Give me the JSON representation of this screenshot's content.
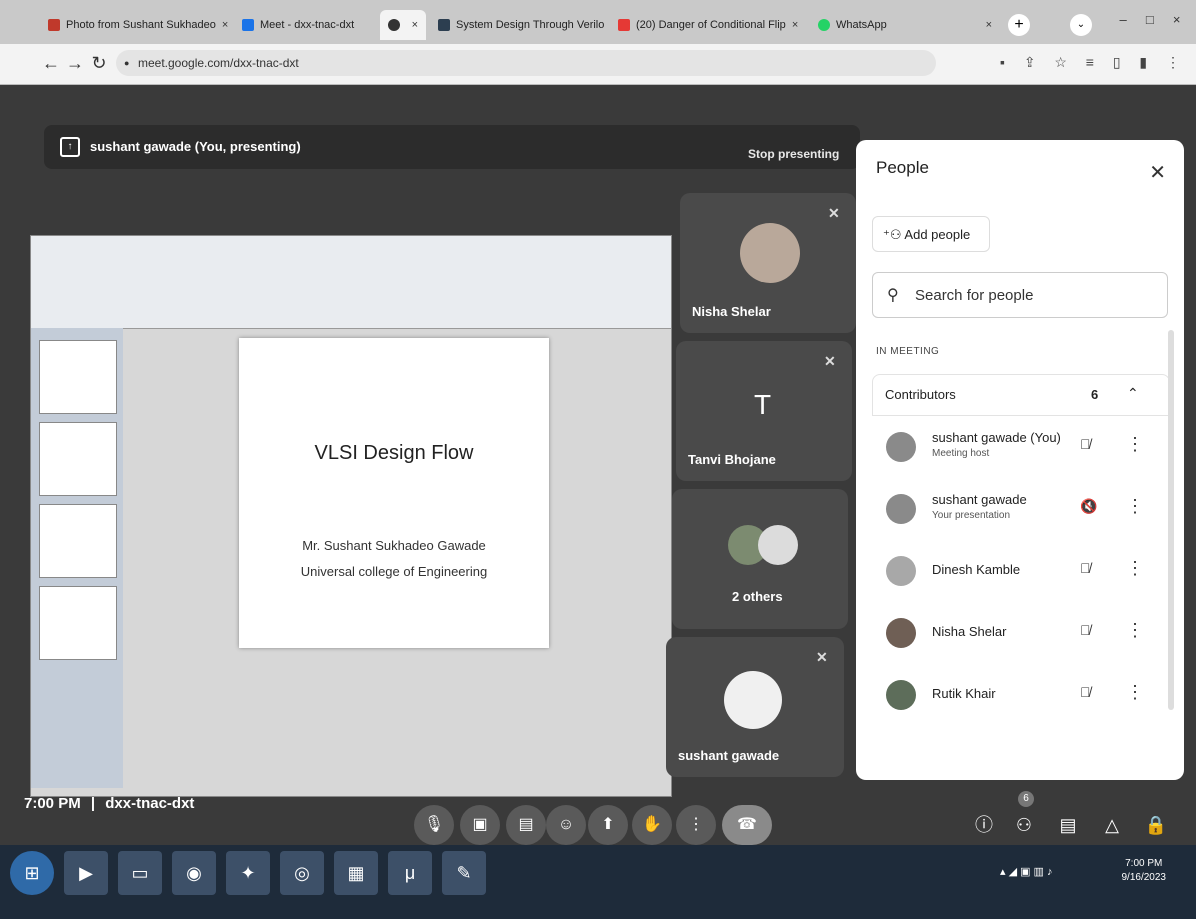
{
  "tabs": [
    {
      "label": "Photo from Sushant Sukhadeo",
      "favicon": "gmail-icon",
      "color": "#c0392b"
    },
    {
      "label": "Meet - dxx-tnac-dxt",
      "favicon": "meet-icon",
      "color": "#1a73e8"
    },
    {
      "label": "",
      "favicon": "audio-tab-icon",
      "color": "#333333"
    },
    {
      "label": "System Design Through Verilo",
      "favicon": "s-icon",
      "color": "#2c3e50"
    },
    {
      "label": "(20) Danger of Conditional Flip",
      "favicon": "youtube-icon",
      "color": "#e53935"
    },
    {
      "label": "WhatsApp",
      "favicon": "whatsapp-icon",
      "color": "#25d366"
    }
  ],
  "browser": {
    "url": "meet.google.com/dxx-tnac-dxt"
  },
  "presenting": {
    "label": "sushant gawade (You, presenting)",
    "stop": "Stop presenting"
  },
  "slide": {
    "title": "VLSI Design Flow",
    "line1": "Mr. Sushant Sukhadeo Gawade",
    "line2": "Universal college of Engineering"
  },
  "tiles": [
    {
      "name": "Nisha Shelar"
    },
    {
      "name": "Tanvi Bhojane",
      "initial": "T"
    },
    {
      "name": "2 others"
    },
    {
      "name": "sushant gawade"
    }
  ],
  "people": {
    "title": "People",
    "add": "Add people",
    "search_placeholder": "Search for people",
    "section": "IN MEETING",
    "group": "Contributors",
    "count": "6",
    "list": [
      {
        "name": "sushant gawade (You)",
        "sub": "Meeting host"
      },
      {
        "name": "sushant gawade",
        "sub": "Your presentation"
      },
      {
        "name": "Dinesh Kamble",
        "sub": ""
      },
      {
        "name": "Nisha Shelar",
        "sub": ""
      },
      {
        "name": "Rutik Khair",
        "sub": ""
      }
    ]
  },
  "meeting": {
    "time": "7:00 PM",
    "code": "dxx-tnac-dxt",
    "people_badge": "6"
  },
  "taskbar": {
    "time": "7:00 PM",
    "date": "9/16/2023"
  }
}
